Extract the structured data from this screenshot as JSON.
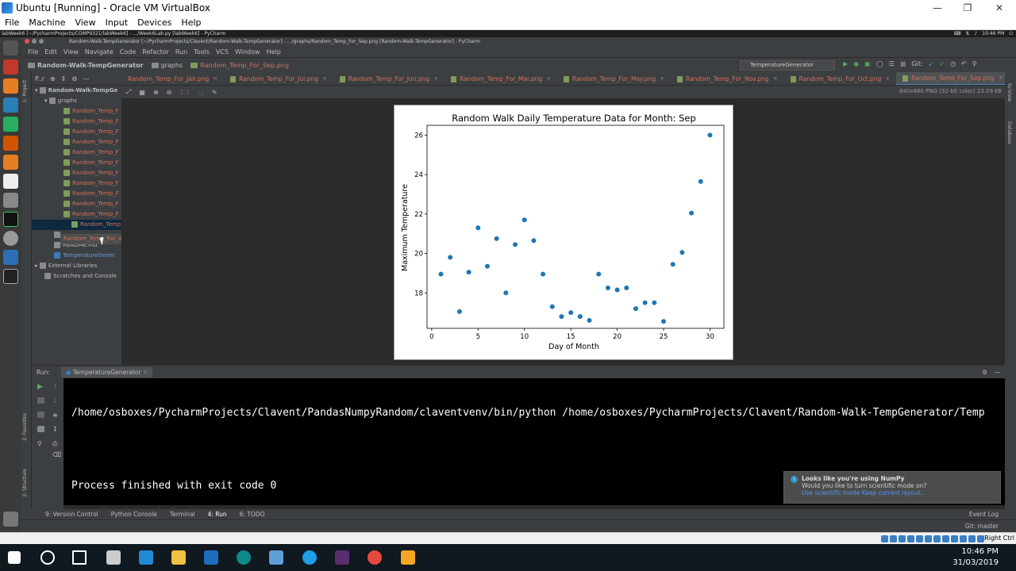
{
  "vbox": {
    "title": "Ubuntu [Running] - Oracle VM VirtualBox",
    "menu": [
      "File",
      "Machine",
      "View",
      "Input",
      "Devices",
      "Help"
    ],
    "status_right": "Right Ctrl"
  },
  "ubuntu_bar": {
    "window_text": "labWeek6 [~/PycharmProjects/COMP9321/labWeek6] - .../Week6Lab.py [labWeek6] - PyCharm",
    "time": "10:46 PM"
  },
  "pycharm": {
    "title": "Random-Walk-TempGenerator [~/PycharmProjects/Clavent/Random-Walk-TempGenerator] - .../graphs/Random_Temp_For_Sep.png [Random-Walk-TempGenerator] - PyCharm",
    "menu": [
      "File",
      "Edit",
      "View",
      "Navigate",
      "Code",
      "Refactor",
      "Run",
      "Tools",
      "VCS",
      "Window",
      "Help"
    ],
    "breadcrumb": [
      "Random-Walk-TempGenerator",
      "graphs",
      "Random_Temp_For_Sep.png"
    ],
    "run_config": "TemperatureGenerator",
    "git_label": "Git:",
    "project_panel_label": "P..r",
    "side_labels": {
      "project": "1: Project",
      "favorites": "2: Favorites",
      "structure": "2: Structure",
      "sciview": "SciView",
      "database": "Database"
    },
    "tree": {
      "root": "Random-Walk-TempGe",
      "graphs": "graphs",
      "files": [
        "Random_Temp_F",
        "Random_Temp_F",
        "Random_Temp_F",
        "Random_Temp_F",
        "Random_Temp_F",
        "Random_Temp_F",
        "Random_Temp_F",
        "Random_Temp_F",
        "Random_Temp_F",
        "Random_Temp_F",
        "Random_Temp_F",
        "Random_Temp_F"
      ],
      "csv": "Random_Temp_For_All Months.csv",
      "readme": "README.md",
      "script": "TemperatureGener",
      "external": "External Libraries",
      "scratches": "Scratches and Console"
    },
    "tabs": [
      "Random_Temp_For_Jan.png",
      "Random_Temp_For_Jul.png",
      "Random_Temp_For_Jun.png",
      "Random_Temp_For_Mar.png",
      "Random_Temp_For_May.png",
      "Random_Temp_For_Nov.png",
      "Random_Temp_For_Oct.png",
      "Random_Temp_For_Sep.png"
    ],
    "image_info": "640x480 PNG (32-bit color) 23.09 kB",
    "run": {
      "label": "Run:",
      "tab": "TemperatureGenerator",
      "line1": "/home/osboxes/PycharmProjects/Clavent/PandasNumpyRandom/claventvenv/bin/python /home/osboxes/PycharmProjects/Clavent/Random-Walk-TempGenerator/Temp",
      "line2": "Process finished with exit code 0"
    },
    "notification": {
      "title": "Looks like you're using NumPy",
      "body": "Would you like to turn scientific mode on?",
      "links": "Use scientific mode  Keep current layout..."
    },
    "bottom_tabs": [
      "9: Version Control",
      "Python Console",
      "Terminal",
      "4: Run",
      "6: TODO"
    ],
    "event_log": "Event Log",
    "git_branch": "Git: master"
  },
  "taskbar": {
    "time": "10:46 PM",
    "date": "31/03/2019"
  },
  "chart_data": {
    "type": "scatter",
    "title": "Random Walk Daily Temperature Data for Month: Sep",
    "xlabel": "Day of Month",
    "ylabel": "Maximum Temperature",
    "xlim": [
      -0.5,
      31.5
    ],
    "ylim": [
      16.2,
      26.5
    ],
    "xticks": [
      0,
      5,
      10,
      15,
      20,
      25,
      30
    ],
    "yticks": [
      18,
      20,
      22,
      24,
      26
    ],
    "color": "#1f77b4",
    "x": [
      1,
      2,
      3,
      4,
      5,
      6,
      7,
      8,
      9,
      10,
      11,
      12,
      13,
      14,
      15,
      16,
      17,
      18,
      19,
      20,
      21,
      22,
      23,
      24,
      25,
      26,
      27,
      28,
      29,
      30
    ],
    "y": [
      18.95,
      19.8,
      17.05,
      19.05,
      21.3,
      19.35,
      20.75,
      18.0,
      20.45,
      21.7,
      20.65,
      18.95,
      17.3,
      16.8,
      17.0,
      16.8,
      16.6,
      18.95,
      18.25,
      18.15,
      18.25,
      17.2,
      17.5,
      17.5,
      16.55,
      19.45,
      20.05,
      22.05,
      23.65,
      26.0
    ]
  }
}
